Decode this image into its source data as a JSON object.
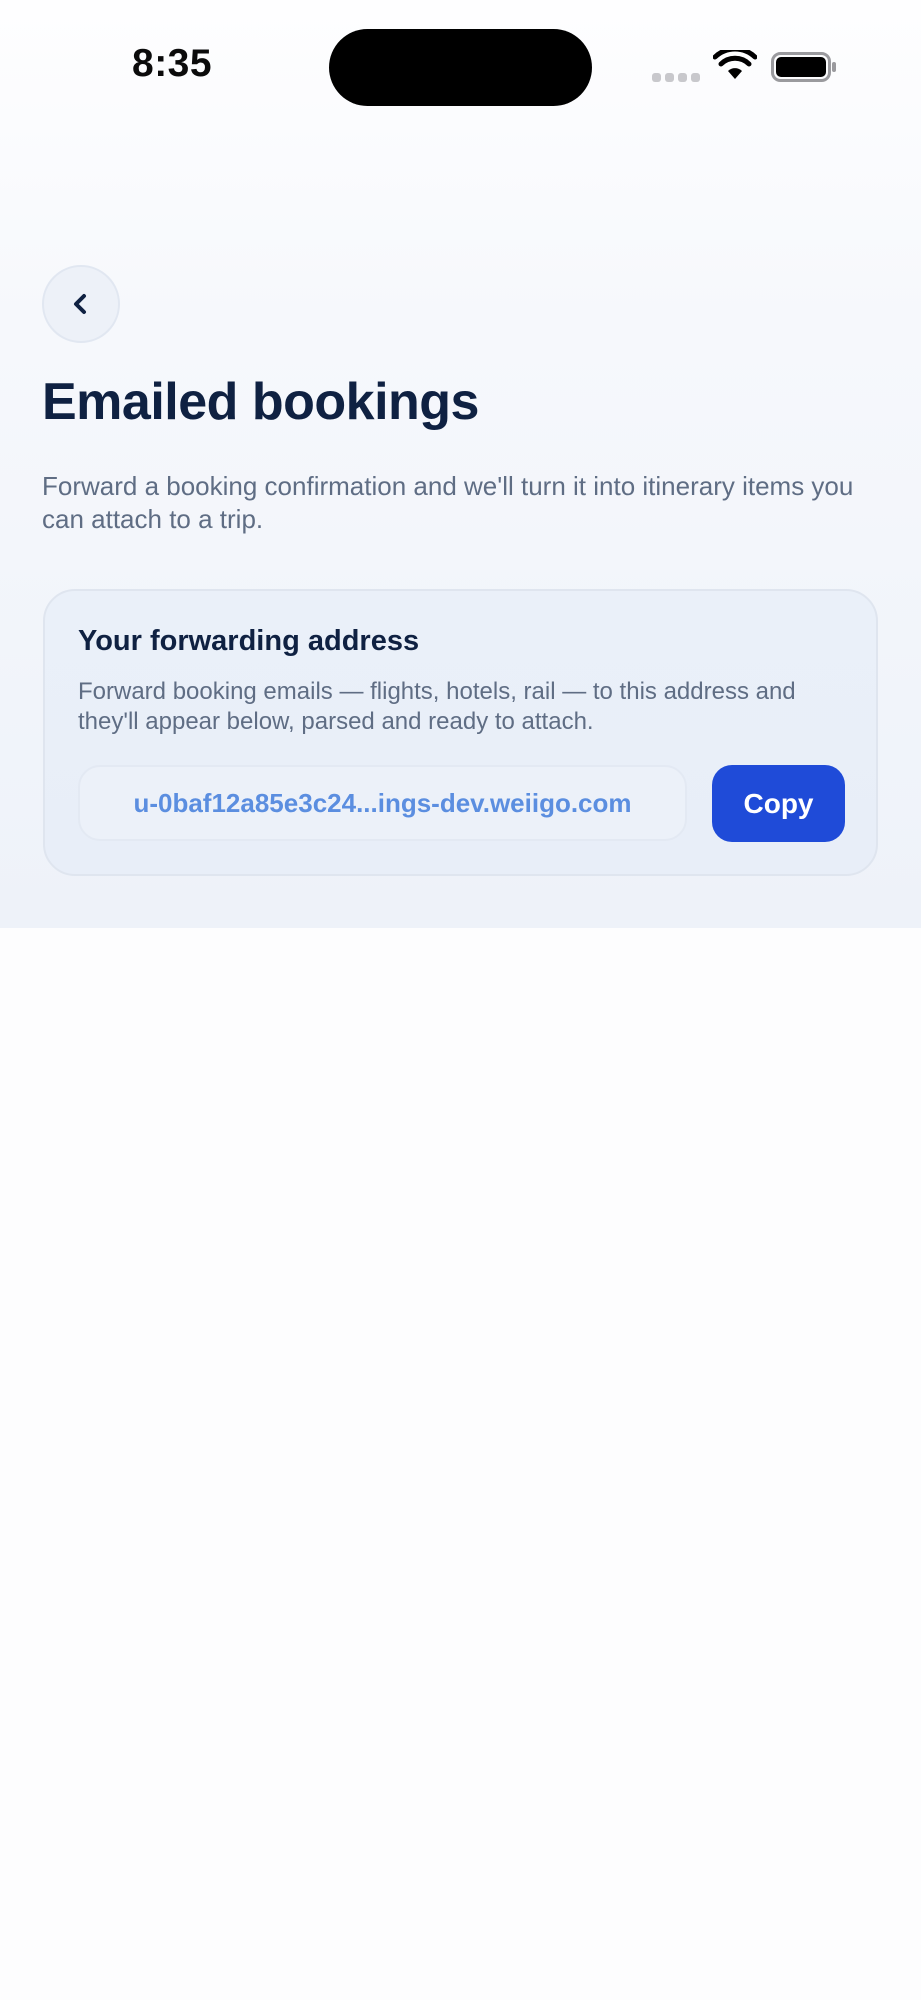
{
  "status_bar": {
    "time": "8:35"
  },
  "header": {
    "back_icon": "chevron-left-icon",
    "title": "Emailed bookings",
    "subtitle": "Forward a booking confirmation and we'll turn it into itinerary items you can attach to a trip."
  },
  "forwarding_card": {
    "title": "Your forwarding address",
    "description": "Forward booking emails — flights, hotels, rail — to this address and they'll appear below, parsed and ready to attach.",
    "address": "u-0baf12a85e3c24...ings-dev.weiigo.com",
    "copy_label": "Copy"
  },
  "colors": {
    "primary": "#1f4bd8",
    "title_text": "#0f2142",
    "body_text": "#5f6d84",
    "address_text": "#5b8ee0"
  }
}
